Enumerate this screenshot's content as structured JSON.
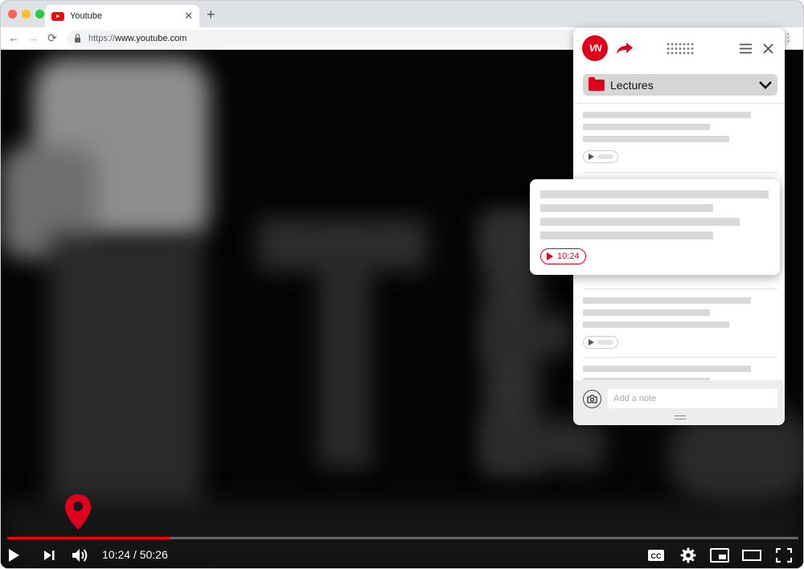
{
  "browser": {
    "tab_title": "Youtube",
    "tab_close": "✕",
    "new_tab": "+",
    "url_prefix": "https://",
    "url_host": "www.youtube.com",
    "back": "←",
    "forward": "→",
    "reload": "⟳",
    "menu": "⋮"
  },
  "player": {
    "current_time": "10:24",
    "duration": "50:26",
    "time_display": "10:24 / 50:26",
    "played_fraction": 0.206,
    "buffered_fraction": 0.163,
    "cc_label": "CC"
  },
  "panel": {
    "folder_name": "Lectures",
    "note_placeholder": "Add a note",
    "highlight_timestamp": "10:24"
  },
  "colors": {
    "accent": "#e0001b",
    "youtube_red": "#ff0000"
  }
}
